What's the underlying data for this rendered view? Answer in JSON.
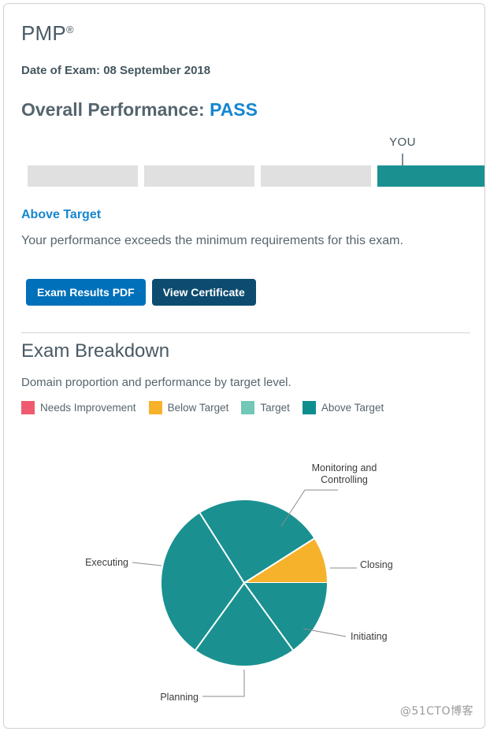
{
  "exam": {
    "name": "PMP",
    "registered_mark": "®",
    "date_label": "Date of Exam: 08 September 2018",
    "overall_label": "Overall Performance:",
    "overall_result": "PASS"
  },
  "performance_bar": {
    "you_marker_label": "YOU",
    "segments": [
      {
        "name": "Needs Improvement",
        "state": "inactive"
      },
      {
        "name": "Below Target",
        "state": "inactive"
      },
      {
        "name": "Target",
        "state": "inactive"
      },
      {
        "name": "Above Target",
        "state": "active"
      }
    ],
    "band_name": "Above Target",
    "band_description": "Your performance exceeds the minimum requirements for this exam."
  },
  "actions": {
    "pdf_label": "Exam Results PDF",
    "certificate_label": "View Certificate"
  },
  "breakdown": {
    "title": "Exam Breakdown",
    "subtitle": "Domain proportion and performance by target level."
  },
  "legend": [
    {
      "label": "Needs Improvement",
      "color": "#ef5a70"
    },
    {
      "label": "Below Target",
      "color": "#f7b22b"
    },
    {
      "label": "Target",
      "color": "#73c7b7"
    },
    {
      "label": "Above Target",
      "color": "#0d8e8c"
    }
  ],
  "colors": {
    "accent_blue": "#1686cf",
    "button_primary": "#0070ba",
    "button_secondary": "#0d4c70",
    "bar_active": "#1a9190",
    "bar_inactive": "#e0e0e0",
    "text": "#55656d",
    "needs_improvement": "#ef5a70",
    "below_target": "#f7b22b",
    "target": "#73c7b7",
    "above_target": "#0d8e8c"
  },
  "chart_data": {
    "type": "pie",
    "title": "Exam Breakdown",
    "subtitle": "Domain proportion and performance by target level.",
    "legend_position": "top",
    "legend": [
      "Needs Improvement",
      "Below Target",
      "Target",
      "Above Target"
    ],
    "categories": [
      "Closing",
      "Monitoring and Controlling",
      "Executing",
      "Planning",
      "Initiating"
    ],
    "values": [
      9,
      25,
      31,
      20,
      15
    ],
    "performance": [
      "Below Target",
      "Above Target",
      "Above Target",
      "Above Target",
      "Above Target"
    ],
    "slice_colors": [
      "#f7b22b",
      "#1a9190",
      "#1a9190",
      "#1a9190",
      "#1a9190"
    ],
    "start_angle_deg": 0,
    "direction": "clockwise",
    "labels": [
      {
        "name": "Closing",
        "text": "Closing"
      },
      {
        "name": "Monitoring and Controlling",
        "text_line1": "Monitoring and",
        "text_line2": "Controlling"
      },
      {
        "name": "Executing",
        "text": "Executing"
      },
      {
        "name": "Planning",
        "text": "Planning"
      },
      {
        "name": "Initiating",
        "text": "Initiating"
      }
    ]
  },
  "watermark": "@51CTO博客"
}
